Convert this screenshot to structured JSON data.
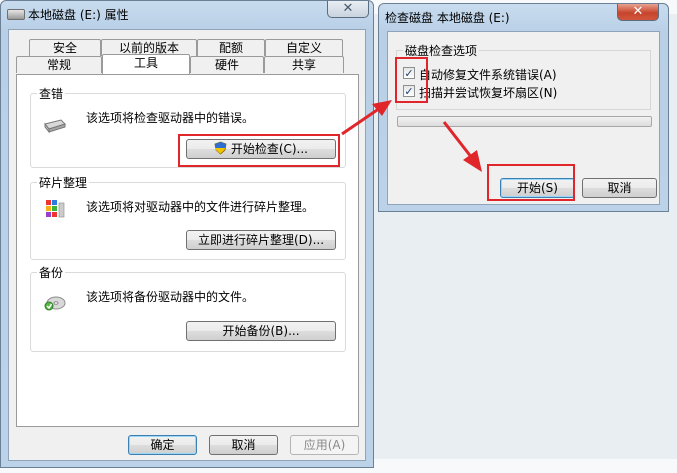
{
  "properties_window": {
    "title": "本地磁盘 (E:) 属性",
    "tabs_row1": [
      "安全",
      "以前的版本",
      "配额",
      "自定义"
    ],
    "tabs_row2": [
      "常规",
      "工具",
      "硬件",
      "共享"
    ],
    "active_tab": "工具",
    "error_check": {
      "label": "查错",
      "description": "该选项将检查驱动器中的错误。",
      "button": "开始检查(C)..."
    },
    "defrag": {
      "label": "碎片整理",
      "description": "该选项将对驱动器中的文件进行碎片整理。",
      "button": "立即进行碎片整理(D)..."
    },
    "backup": {
      "label": "备份",
      "description": "该选项将备份驱动器中的文件。",
      "button": "开始备份(B)..."
    },
    "buttons": {
      "ok": "确定",
      "cancel": "取消",
      "apply": "应用(A)"
    }
  },
  "check_disk_dialog": {
    "title": "检查磁盘 本地磁盘 (E:)",
    "options_label": "磁盘检查选项",
    "option1": {
      "label": "自动修复文件系统错误(A)",
      "checked": true
    },
    "option2": {
      "label": "扫描并尝试恢复坏扇区(N)",
      "checked": true
    },
    "progress": 0,
    "buttons": {
      "start": "开始(S)",
      "cancel": "取消"
    }
  },
  "highlight_color": "#e0262b",
  "icons": [
    "drive-icon",
    "shield-icon",
    "defrag-icon",
    "backup-icon",
    "close-icon"
  ]
}
